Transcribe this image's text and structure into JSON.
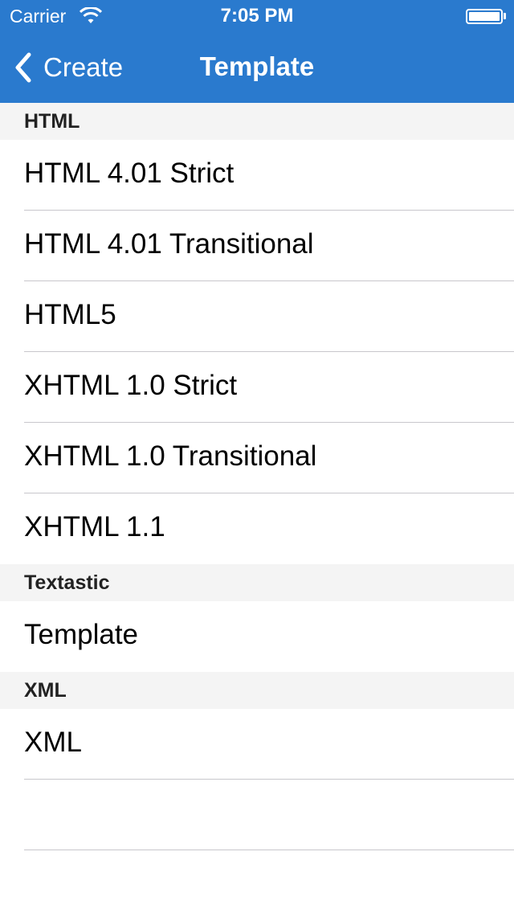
{
  "status_bar": {
    "carrier": "Carrier",
    "time": "7:05 PM"
  },
  "nav": {
    "back_label": "Create",
    "title": "Template"
  },
  "colors": {
    "nav_background": "#2a7ace",
    "section_background": "#f4f4f4",
    "separator": "#c8c7cc"
  },
  "sections": [
    {
      "header": "HTML",
      "items": [
        "HTML 4.01 Strict",
        "HTML 4.01 Transitional",
        "HTML5",
        "XHTML 1.0 Strict",
        "XHTML 1.0 Transitional",
        "XHTML 1.1"
      ]
    },
    {
      "header": "Textastic",
      "items": [
        "Template"
      ]
    },
    {
      "header": "XML",
      "items": [
        "XML"
      ]
    }
  ]
}
